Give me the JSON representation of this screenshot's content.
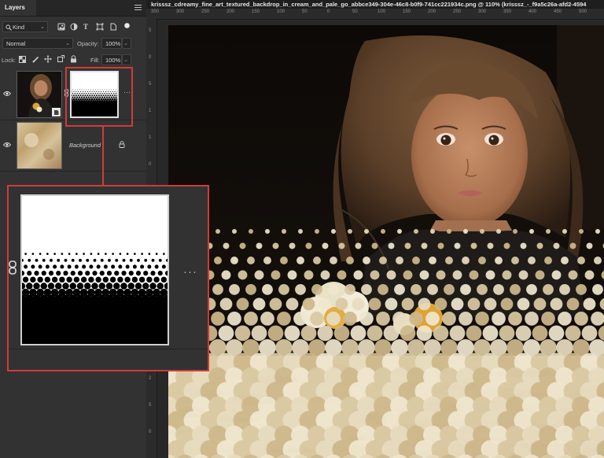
{
  "panel": {
    "tab_label": "Layers",
    "filter": {
      "label": "Kind"
    },
    "blend_mode": "Normal",
    "opacity": {
      "label": "Opacity:",
      "value": "100%"
    },
    "lock": {
      "label": "Lock:"
    },
    "fill": {
      "label": "Fill:",
      "value": "100%"
    }
  },
  "layers": [
    {
      "name": "",
      "visible": true,
      "has_mask": true
    },
    {
      "name": "Background",
      "visible": true,
      "locked": true
    }
  ],
  "document": {
    "title": "krisssz_cdreamy_fine_art_textured_backdrop_in_cream_and_pale_go_abbce349-304e-46c8-b0f9-741cc221934c.png @ 110% (krisssz_-_f9a5c26a-afd2-4594",
    "ruler_top": [
      "350",
      "300",
      "250",
      "200",
      "150",
      "100",
      "50",
      "0",
      "50",
      "100",
      "150",
      "200",
      "250",
      "300",
      "350",
      "400",
      "450",
      "500"
    ],
    "ruler_left": [
      "5",
      "0",
      "5",
      "1",
      "1",
      "0",
      "0",
      "1",
      "5",
      "0",
      "2",
      "0",
      "0",
      "2",
      "5",
      "0"
    ]
  },
  "colors": {
    "accent_highlight": "#d23a3a",
    "panel_bg": "#323232",
    "canvas_bg": "#0c0a08"
  },
  "icons": [
    "search-icon",
    "chevron-down-icon",
    "pixel-filter-icon",
    "adjustment-filter-icon",
    "type-filter-icon",
    "shape-filter-icon",
    "smart-object-filter-icon",
    "eye-icon",
    "lock-icon",
    "link-icon",
    "more-icon",
    "panel-menu-icon"
  ]
}
